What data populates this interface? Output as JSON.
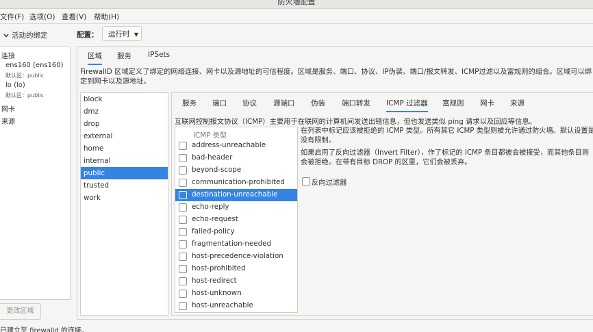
{
  "window": {
    "title": "防火墙配置"
  },
  "menubar": [
    {
      "label": "文件(F)"
    },
    {
      "label": "选项(O)"
    },
    {
      "label": "查看(V)"
    },
    {
      "label": "帮助(H)"
    }
  ],
  "left": {
    "header": "活动的绑定",
    "header_icon": "chevron-down-icon",
    "bindings": {
      "connections_label": "连接",
      "items": [
        {
          "name": "ens160 (ens160)",
          "zone": "默认区：public"
        },
        {
          "name": "lo (lo)",
          "zone": "默认区：public"
        }
      ],
      "interfaces_label": "网卡",
      "sources_label": "来源"
    },
    "change_zone_button": "更改区域"
  },
  "status": "已建立至 firewalld 的连接。",
  "config": {
    "label": "配置：",
    "value": "运行时",
    "arrow": "▼"
  },
  "top_tabs": [
    {
      "label": "区域",
      "active": true
    },
    {
      "label": "服务",
      "active": false
    },
    {
      "label": "IPSets",
      "active": false
    }
  ],
  "zone_description": "FirewallD 区域定义了绑定的网络连接、网卡以及源地址的可信程度。区域是服务、端口、协议、IP伪装、端口/报文转发、ICMP过滤以及富规则的组合。区域可以绑定到网卡以及源地址。",
  "zones": [
    {
      "name": "block",
      "selected": false
    },
    {
      "name": "dmz",
      "selected": false
    },
    {
      "name": "drop",
      "selected": false
    },
    {
      "name": "external",
      "selected": false
    },
    {
      "name": "home",
      "selected": false
    },
    {
      "name": "internal",
      "selected": false
    },
    {
      "name": "public",
      "selected": true
    },
    {
      "name": "trusted",
      "selected": false
    },
    {
      "name": "work",
      "selected": false
    }
  ],
  "zone_tabs": [
    {
      "label": "服务",
      "active": false
    },
    {
      "label": "端口",
      "active": false
    },
    {
      "label": "协议",
      "active": false
    },
    {
      "label": "源端口",
      "active": false
    },
    {
      "label": "伪装",
      "active": false
    },
    {
      "label": "端口转发",
      "active": false
    },
    {
      "label": "ICMP 过滤器",
      "active": true
    },
    {
      "label": "富规则",
      "active": false
    },
    {
      "label": "网卡",
      "active": false
    },
    {
      "label": "来源",
      "active": false
    }
  ],
  "icmp": {
    "description": "互联网控制报文协议（ICMP）主要用于在联网的计算机间发送出错信息，但也发送类似 ping 请求以及回应等信息。",
    "column_header": "ICMP 类型",
    "types": [
      {
        "name": "address-unreachable",
        "selected": false,
        "checked": false
      },
      {
        "name": "bad-header",
        "selected": false,
        "checked": false
      },
      {
        "name": "beyond-scope",
        "selected": false,
        "checked": false
      },
      {
        "name": "communication-prohibited",
        "selected": false,
        "checked": false
      },
      {
        "name": "destination-unreachable",
        "selected": true,
        "checked": false
      },
      {
        "name": "echo-reply",
        "selected": false,
        "checked": false
      },
      {
        "name": "echo-request",
        "selected": false,
        "checked": false
      },
      {
        "name": "failed-policy",
        "selected": false,
        "checked": false
      },
      {
        "name": "fragmentation-needed",
        "selected": false,
        "checked": false
      },
      {
        "name": "host-precedence-violation",
        "selected": false,
        "checked": false
      },
      {
        "name": "host-prohibited",
        "selected": false,
        "checked": false
      },
      {
        "name": "host-redirect",
        "selected": false,
        "checked": false
      },
      {
        "name": "host-unknown",
        "selected": false,
        "checked": false
      },
      {
        "name": "host-unreachable",
        "selected": false,
        "checked": false
      }
    ],
    "help_1": "在列表中标记应该被拒绝的 ICMP 类型。所有其它 ICMP 类型则被允许通过防火墙。默认设置是没有限制。",
    "help_2": "如果启用了反向过滤器（Invert Filter），作了标记的 ICMP 条目都被会被接受，而其他条目则会被拒绝。在带有目标 DROP 的区里，它们会被丢弃。",
    "invert_label": "反向过滤器",
    "invert_checked": false
  },
  "colors": {
    "accent": "#3584e4",
    "background": "#f6f5f4",
    "list_bg": "#ffffff",
    "text": "#2e3436"
  }
}
